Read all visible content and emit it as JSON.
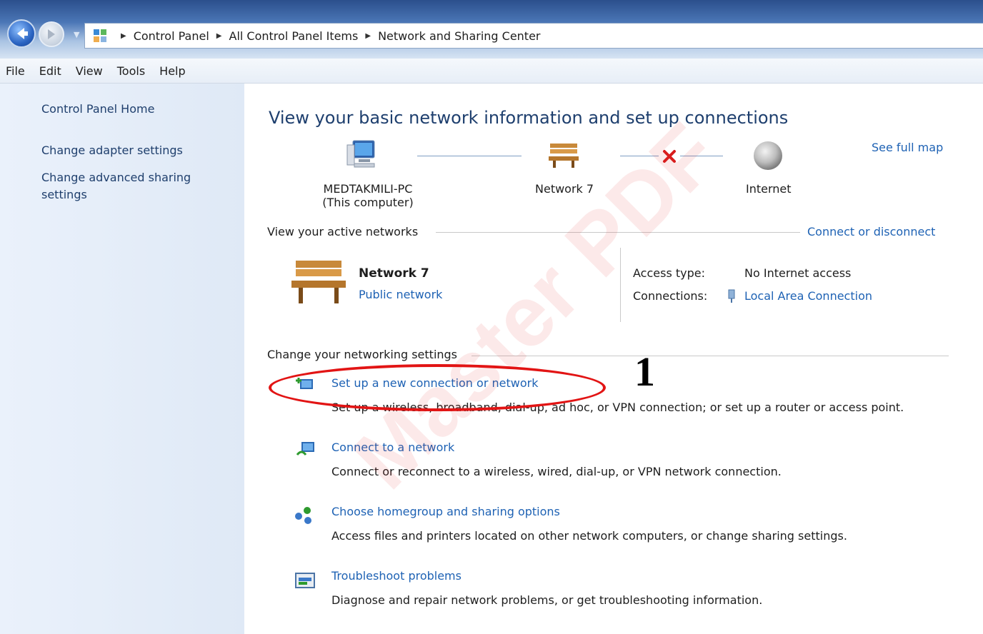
{
  "address": {
    "crumbs": [
      "Control Panel",
      "All Control Panel Items",
      "Network and Sharing Center"
    ]
  },
  "menu": [
    "File",
    "Edit",
    "View",
    "Tools",
    "Help"
  ],
  "sidebar": {
    "home": "Control Panel Home",
    "adapter": "Change adapter settings",
    "advanced_line1": "Change advanced sharing",
    "advanced_line2": "settings"
  },
  "main": {
    "title": "View your basic network information and set up connections",
    "see_full_map": "See full map",
    "map": {
      "computer_name": "MEDTAKMILI-PC",
      "computer_sub": "(This computer)",
      "network": "Network 7",
      "internet": "Internet"
    },
    "active": {
      "header": "View your active networks",
      "connect_link": "Connect or disconnect",
      "network_name": "Network 7",
      "network_type": "Public network",
      "access_label": "Access type:",
      "access_value": "No Internet access",
      "connections_label": "Connections:",
      "connections_value": "Local Area Connection"
    },
    "change_header": "Change your networking settings",
    "tasks": [
      {
        "title": "Set up a new connection or network",
        "desc": "Set up a wireless, broadband, dial-up, ad hoc, or VPN connection; or set up a router or access point."
      },
      {
        "title": "Connect to a network",
        "desc": "Connect or reconnect to a wireless, wired, dial-up, or VPN network connection."
      },
      {
        "title": "Choose homegroup and sharing options",
        "desc": "Access files and printers located on other network computers, or change sharing settings."
      },
      {
        "title": "Troubleshoot problems",
        "desc": "Diagnose and repair network problems, or get troubleshooting information."
      }
    ]
  },
  "annotation": {
    "step": "1"
  },
  "icons": {
    "back": "back-arrow-icon",
    "forward": "forward-arrow-icon",
    "control_panel": "control-panel-icon",
    "computer": "computer-icon",
    "bench": "bench-network-icon",
    "disconnected": "red-x-icon",
    "globe": "globe-icon"
  },
  "colors": {
    "link": "#1e62b4",
    "annotation": "#e21414",
    "title": "#1e3f6e"
  }
}
